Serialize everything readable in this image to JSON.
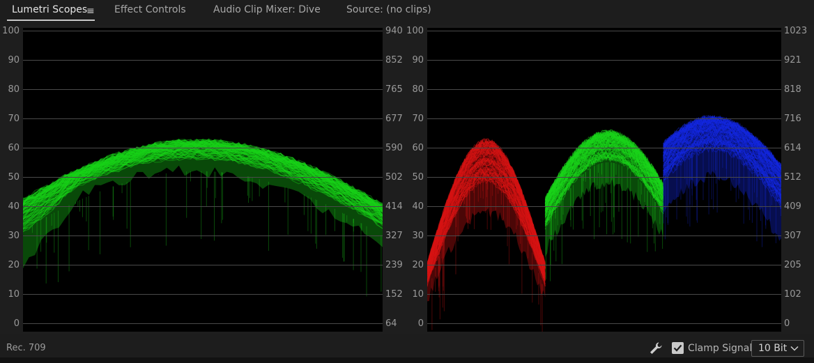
{
  "tabs": [
    {
      "label": "Lumetri Scopes",
      "active": true
    },
    {
      "label": "Effect Controls",
      "active": false
    },
    {
      "label": "Audio Clip Mixer: Dive",
      "active": false
    },
    {
      "label": "Source: (no clips)",
      "active": false
    }
  ],
  "menu_icon": "≡",
  "left_scope": {
    "left_ticks": [
      "100",
      "90",
      "80",
      "70",
      "60",
      "50",
      "40",
      "30",
      "20",
      "10",
      "0"
    ],
    "right_ticks": [
      "940",
      "852",
      "765",
      "677",
      "590",
      "502",
      "414",
      "327",
      "239",
      "152",
      "64"
    ],
    "trace_color": "#19d219"
  },
  "right_scope": {
    "left_ticks": [
      "100",
      "90",
      "80",
      "70",
      "60",
      "50",
      "40",
      "30",
      "20",
      "10",
      "0"
    ],
    "right_ticks": [
      "1023",
      "921",
      "818",
      "716",
      "614",
      "512",
      "409",
      "307",
      "205",
      "102",
      "0"
    ],
    "parade_colors": [
      "#d61414",
      "#1ad41a",
      "#1428e0"
    ]
  },
  "status": {
    "color_space": "Rec. 709",
    "settings_icon": "wrench-icon",
    "clamp_label": "Clamp Signal",
    "clamp_checked": true,
    "bit_depth": "10 Bit"
  }
}
